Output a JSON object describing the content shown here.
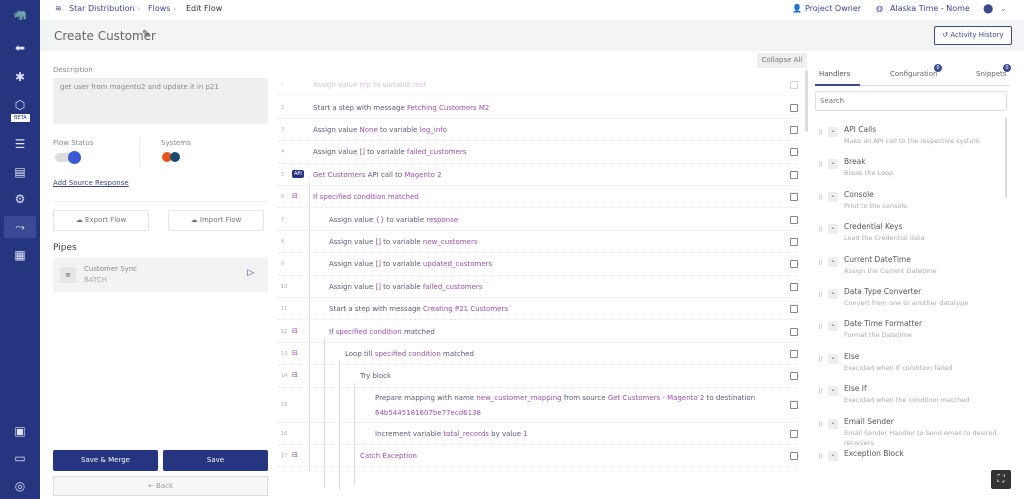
{
  "breadcrumb": [
    "Star Distribution",
    "Flows",
    "Edit Flow"
  ],
  "header": {
    "role": "Project Owner",
    "timezone": "Alaska Time - Nome"
  },
  "title": "Create Customer",
  "activity_history": "Activity History",
  "sidebar": {
    "beta": "BETA"
  },
  "left": {
    "description_label": "Description",
    "description": "get user from magento2 and update it in p21",
    "flow_status_label": "Flow Status",
    "flow_status_on": true,
    "systems_label": "Systems",
    "add_source": "Add Source Response",
    "export": "Export Flow",
    "import": "Import Flow",
    "pipes_label": "Pipes",
    "pipe_name": "Customer Sync",
    "pipe_type": "BATCH",
    "save_merge": "Save & Merge",
    "save": "Save",
    "back": "Back"
  },
  "collapse_all": "Collapse All",
  "steps": [
    {
      "n": "1",
      "level": 0,
      "faded": true,
      "parts": [
        [
          "Assign value ",
          0
        ],
        [
          "tep",
          1
        ],
        [
          " to variable ",
          0
        ],
        [
          "test",
          1
        ]
      ]
    },
    {
      "n": "2",
      "level": 0,
      "parts": [
        [
          "Start a step with message ",
          0
        ],
        [
          "Fetching Customers M2",
          1
        ]
      ]
    },
    {
      "n": "3",
      "level": 0,
      "parts": [
        [
          "Assign value ",
          0
        ],
        [
          "None",
          1
        ],
        [
          " to variable ",
          0
        ],
        [
          "log_info",
          1
        ]
      ]
    },
    {
      "n": "4",
      "level": 0,
      "parts": [
        [
          "Assign value ",
          0
        ],
        [
          "[]",
          1
        ],
        [
          " to variable ",
          0
        ],
        [
          "failed_customers",
          1
        ]
      ]
    },
    {
      "n": "5",
      "level": 0,
      "icon": "API",
      "parts": [
        [
          "Get Customers",
          1
        ],
        [
          " API call to ",
          0
        ],
        [
          "Magento 2",
          1
        ]
      ]
    },
    {
      "n": "6",
      "level": 0,
      "icon": "⊟",
      "parts": [
        [
          "If specified condition matched",
          1
        ]
      ]
    },
    {
      "n": "7",
      "level": 1,
      "parts": [
        [
          "Assign value ",
          0
        ],
        [
          "{}",
          1
        ],
        [
          " to variable ",
          0
        ],
        [
          "response",
          1
        ]
      ]
    },
    {
      "n": "8",
      "level": 1,
      "parts": [
        [
          "Assign value ",
          0
        ],
        [
          "[]",
          1
        ],
        [
          " to variable ",
          0
        ],
        [
          "new_customers",
          1
        ]
      ]
    },
    {
      "n": "9",
      "level": 1,
      "parts": [
        [
          "Assign value ",
          0
        ],
        [
          "[]",
          1
        ],
        [
          " to variable ",
          0
        ],
        [
          "updated_customers",
          1
        ]
      ]
    },
    {
      "n": "10",
      "level": 1,
      "parts": [
        [
          "Assign value ",
          0
        ],
        [
          "[]",
          1
        ],
        [
          " to variable ",
          0
        ],
        [
          "failed_customers",
          1
        ]
      ]
    },
    {
      "n": "11",
      "level": 1,
      "parts": [
        [
          "Start a step with message ",
          0
        ],
        [
          "Creating P21 Customers",
          1
        ]
      ]
    },
    {
      "n": "12",
      "level": 1,
      "icon": "⊟",
      "parts": [
        [
          "If ",
          0
        ],
        [
          "specified condition",
          1
        ],
        [
          " matched",
          0
        ]
      ]
    },
    {
      "n": "13",
      "level": 2,
      "icon": "⊟",
      "parts": [
        [
          "Loop till ",
          0
        ],
        [
          "specified condition",
          1
        ],
        [
          " matched",
          0
        ]
      ]
    },
    {
      "n": "14",
      "level": 3,
      "icon": "⊟",
      "parts": [
        [
          "Try block",
          0
        ]
      ]
    },
    {
      "n": "15",
      "level": 4,
      "tall": true,
      "parts": [
        [
          "Prepare mapping with name ",
          0
        ],
        [
          "new_customer_mapping",
          1
        ],
        [
          " from source ",
          0
        ],
        [
          "Get Customers - Magento 2",
          1
        ],
        [
          " to destination ",
          0
        ],
        [
          "64b5445181607be77ecd6138",
          1
        ]
      ]
    },
    {
      "n": "16",
      "level": 4,
      "parts": [
        [
          "Increment variable ",
          0
        ],
        [
          "total_records",
          1
        ],
        [
          " by value ",
          0
        ],
        [
          "1",
          1
        ]
      ]
    },
    {
      "n": "17",
      "level": 3,
      "icon": "⊟",
      "parts": [
        [
          "Catch Exception",
          1
        ]
      ]
    }
  ],
  "right": {
    "tabs": [
      {
        "label": "Handlers",
        "active": true
      },
      {
        "label": "Configuration",
        "badge": "0"
      },
      {
        "label": "Snippets",
        "badge": "0"
      }
    ],
    "search_placeholder": "Search",
    "handlers": [
      {
        "name": "API Calls",
        "desc": "Make an API call to the respective system"
      },
      {
        "name": "Break",
        "desc": "Break the Loop"
      },
      {
        "name": "Console",
        "desc": "Print to the console"
      },
      {
        "name": "Credential Keys",
        "desc": "Load the Credential data"
      },
      {
        "name": "Current DateTime",
        "desc": "Assign the Current Datetime"
      },
      {
        "name": "Data Type Converter",
        "desc": "Convert from one to another datatype"
      },
      {
        "name": "Date Time Formatter",
        "desc": "Format the Datetime"
      },
      {
        "name": "Else",
        "desc": "Executed when If condition failed"
      },
      {
        "name": "Else If",
        "desc": "Executed when the condition matched"
      },
      {
        "name": "Email Sender",
        "desc": "Email Sender Handler to Send email to desired receivers"
      },
      {
        "name": "Exception Block",
        "desc": ""
      }
    ]
  },
  "colors": {
    "sidebar": "#263580",
    "accent": "#3b4a8a",
    "value_text": "#9a4fa8"
  }
}
